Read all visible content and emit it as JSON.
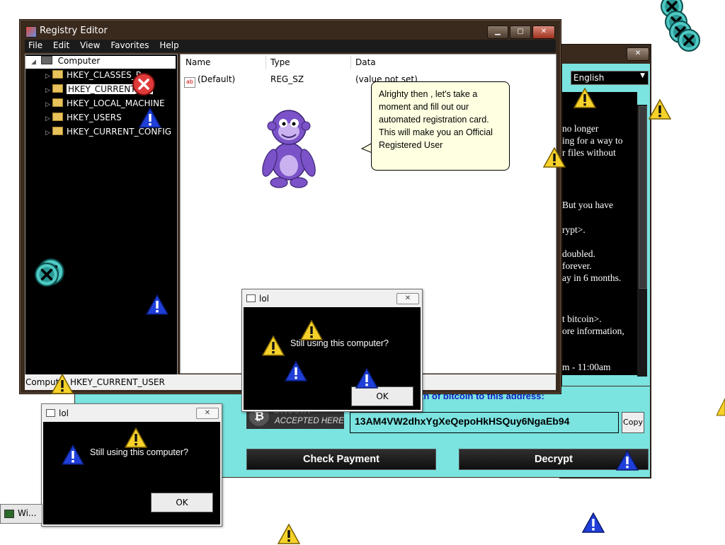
{
  "regedit": {
    "title": "Registry Editor",
    "menu": [
      "File",
      "Edit",
      "View",
      "Favorites",
      "Help"
    ],
    "tree_root": "Computer",
    "tree_items": [
      "HKEY_CLASSES_ROOT",
      "HKEY_CURRENT_USER",
      "HKEY_LOCAL_MACHINE",
      "HKEY_USERS",
      "HKEY_CURRENT_CONFIG"
    ],
    "tree_items_visible": [
      "HKEY_CLASSES_R",
      "HKEY_CURRENT_",
      "HKEY_LOCAL_MACHINE",
      "HKEY_USERS",
      "HKEY_CURRENT_CONFIG"
    ],
    "columns": {
      "name": "Name",
      "type": "Type",
      "data": "Data"
    },
    "row": {
      "name": "(Default)",
      "type": "REG_SZ",
      "data": "(value not set)"
    },
    "status_prefix": "Comput",
    "status_path": "HKEY_CURRENT_USER"
  },
  "bonzi": {
    "bubble_lines": [
      "Alrighty then , let's take a",
      "moment and fill out our",
      "automated registration card.",
      "This will make you an Official",
      "Registered User"
    ]
  },
  "ransom": {
    "language": "English",
    "text_lines": [
      "no longer",
      "ing for a way to",
      "r files without",
      "But you have",
      "rypt>.",
      "doubled.",
      "forever.",
      "ay in 6 months.",
      "t bitcoin>.",
      "ore information,",
      "m - 11:00am"
    ],
    "btc_heading": "th of bitcoin to this address:",
    "bitcoin_logo_word": "bitcoin",
    "bitcoin_accepted": "ACCEPTED HERE",
    "address": "13AM4VW2dhxYgXeQepoHkHSQuy6NgaEb94",
    "copy_label": "Copy",
    "check_label": "Check Payment",
    "decrypt_label": "Decrypt"
  },
  "dialog": {
    "title": "lol",
    "message": "Still using this computer?",
    "ok_label": "OK"
  },
  "taskbar": {
    "label": "Wi..."
  },
  "colors": {
    "ransom_bg": "#7be3e0",
    "frame": "#3a2a1e",
    "bubble": "#ffffe1",
    "link_blue": "#1524c4"
  }
}
